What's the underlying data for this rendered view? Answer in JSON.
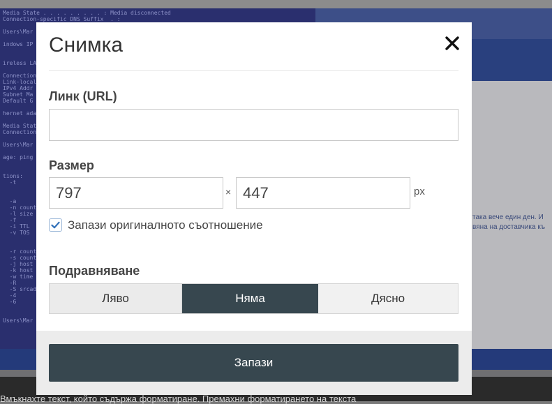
{
  "background": {
    "terminal_lines": [
      "Media State . . . . . . . . . : Media disconnected",
      "Connection-specific DNS Suffix  . :",
      "",
      "Users\\Mar",
      "",
      "indows IP C",
      "",
      "",
      "ireless LAN",
      "",
      "Connection",
      "Link-local",
      "IPv4 Addr",
      "Subnet Ma",
      "Default G",
      "",
      "hernet ada",
      "",
      "Media Stat",
      "Connection",
      "",
      "Users\\Mar",
      "",
      "age: ping",
      "",
      "",
      "tions:",
      "  -t",
      "",
      "",
      "  -a",
      "  -n count",
      "  -l size",
      "  -f",
      "  -i TTL",
      "  -v TOS",
      "",
      "",
      "  -r count",
      "  -s count",
      "  -j host",
      "  -k host",
      "  -w time",
      "  -R",
      "  -S srcad",
      "  -4",
      "  -6",
      "",
      "",
      "Users\\Mar"
    ],
    "right_text": "така вече един ден. И\nвяна на доставчика къ",
    "bottom_text": "Вмъкнахте текст, който съдържа форматиране.   Премахни форматирането на текста"
  },
  "modal": {
    "title": "Снимка",
    "url_label": "Линк (URL)",
    "url_value": "",
    "size_label": "Размер",
    "width_value": "797",
    "times_sign": "×",
    "height_value": "447",
    "unit": "px",
    "keep_ratio_label": "Запази оригиналното съотношение",
    "keep_ratio_checked": true,
    "align_label": "Подравняване",
    "align_options": [
      "Ляво",
      "Няма",
      "Дясно"
    ],
    "align_selected": "Няма",
    "save_label": "Запази"
  },
  "icons": {
    "close": "close-icon",
    "check": "checkmark-icon"
  },
  "colors": {
    "primary_dark": "#37474f",
    "overlay_terminal": "#2a2f6e",
    "checkbox_check": "#2f6fb8"
  }
}
